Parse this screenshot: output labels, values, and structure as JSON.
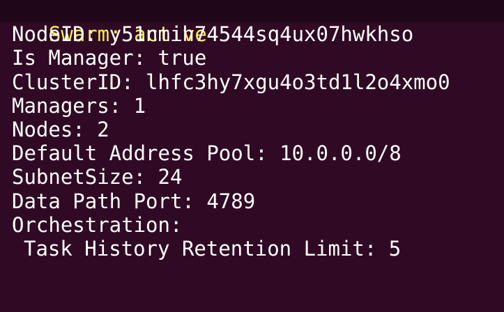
{
  "terminal": {
    "colors": {
      "background": "#300a24",
      "text": "#ffffff",
      "highlight": "#fce94f"
    },
    "top_partial_line": "  -   -  --    -   -   -  -   -  -  -   -  ",
    "swarm_status_label": "Swarm: active",
    "lines": [
      "NodeID: y51nmih74544sq4ux07hwkhso",
      "Is Manager: true",
      "ClusterID: lhfc3hy7xgu4o3td1l2o4xmo0",
      "Managers: 1",
      "Nodes: 2",
      "Default Address Pool: 10.0.0.0/8",
      "SubnetSize: 24",
      "Data Path Port: 4789",
      "Orchestration:"
    ],
    "task_history_line": "Task History Retention Limit: 5"
  }
}
